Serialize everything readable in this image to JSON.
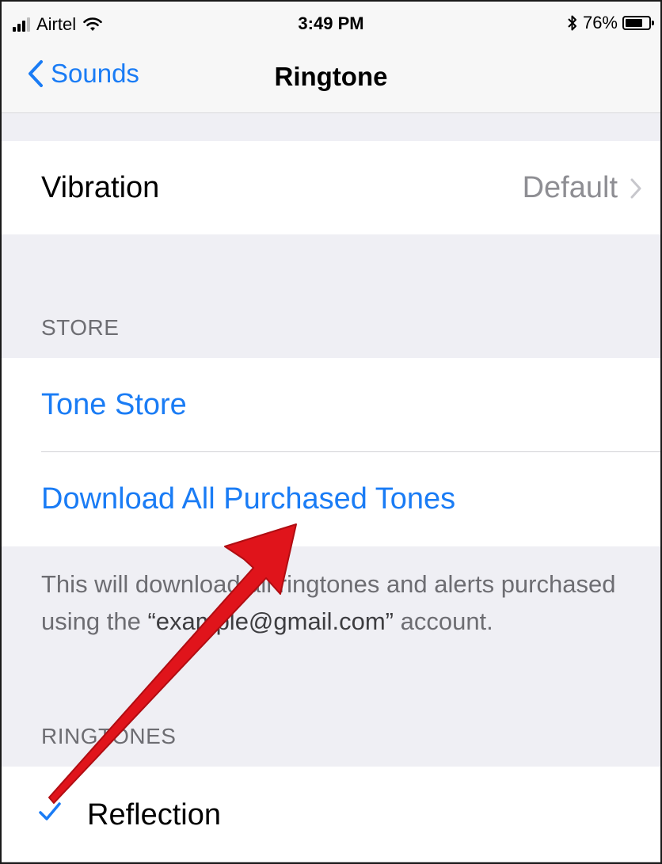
{
  "status_bar": {
    "carrier": "Airtel",
    "time": "3:49 PM",
    "battery_percent": "76%",
    "battery_level": 0.76,
    "icons": [
      "signal-bars-icon",
      "wifi-icon",
      "bluetooth-icon",
      "battery-icon"
    ]
  },
  "nav": {
    "back_label": "Sounds",
    "title": "Ringtone"
  },
  "vibration": {
    "label": "Vibration",
    "value": "Default"
  },
  "store": {
    "header": "STORE",
    "items": [
      {
        "label": "Tone Store"
      },
      {
        "label": "Download All Purchased Tones"
      }
    ],
    "footer_prefix": "This will download all ringtones and alerts purchased using the ",
    "footer_email": "“example@gmail.com”",
    "footer_suffix": " account."
  },
  "ringtones": {
    "header": "RINGTONES",
    "items": [
      {
        "label": "Reflection",
        "selected": true
      }
    ]
  },
  "colors": {
    "accent": "#1a7cf5",
    "background": "#efeff4",
    "secondary_text": "#8e8e93",
    "annotation_arrow": "#e0141b"
  }
}
